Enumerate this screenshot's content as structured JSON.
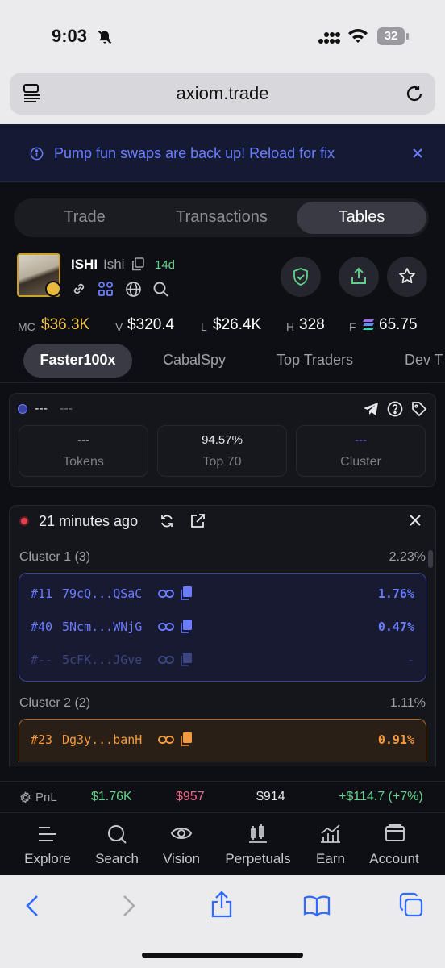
{
  "status": {
    "time": "9:03",
    "battery": "32"
  },
  "browser": {
    "url": "axiom.trade"
  },
  "banner": {
    "text": "Pump fun swaps are back up! Reload for fix"
  },
  "tabs": [
    {
      "label": "Trade"
    },
    {
      "label": "Transactions"
    },
    {
      "label": "Tables"
    }
  ],
  "token": {
    "symbol": "ISHI",
    "name": "Ishi",
    "age": "14d"
  },
  "stats": {
    "mc_label": "MC",
    "mc": "$36.3K",
    "v_label": "V",
    "v": "$320.4",
    "l_label": "L",
    "l": "$26.4K",
    "h_label": "H",
    "h": "328",
    "f_label": "F",
    "f": "65.75"
  },
  "subtabs": [
    {
      "label": "Faster100x"
    },
    {
      "label": "CabalSpy"
    },
    {
      "label": "Top Traders"
    },
    {
      "label": "Dev T"
    }
  ],
  "panel1": {
    "title": "---",
    "subtitle": "---",
    "boxes": [
      {
        "value": "---",
        "label": "Tokens"
      },
      {
        "value": "94.57%",
        "label": "Top 70"
      },
      {
        "value": "---",
        "label": "Cluster"
      }
    ]
  },
  "panel2": {
    "time": "21 minutes ago",
    "clusters": [
      {
        "title": "Cluster 1 (3)",
        "pct": "2.23%",
        "rows": [
          {
            "rank": "#11",
            "addr": "79cQ...QSaC",
            "pct": "1.76%"
          },
          {
            "rank": "#40",
            "addr": "5Ncm...WNjG",
            "pct": "0.47%"
          },
          {
            "rank": "#--",
            "addr": "5cFK...JGve",
            "pct": "-"
          }
        ]
      },
      {
        "title": "Cluster 2 (2)",
        "pct": "1.11%",
        "rows": [
          {
            "rank": "#23",
            "addr": "Dg3y...banH",
            "pct": "0.91%"
          }
        ]
      }
    ]
  },
  "pnl": {
    "label": "PnL",
    "a": "$1.76K",
    "b": "$957",
    "c": "$914",
    "d": "+$114.7 (+7%)"
  },
  "nav": [
    {
      "label": "Explore"
    },
    {
      "label": "Search"
    },
    {
      "label": "Vision"
    },
    {
      "label": "Perpetuals"
    },
    {
      "label": "Earn"
    },
    {
      "label": "Account"
    }
  ],
  "colors": {
    "accent_blue": "#6b7cff",
    "gain": "#5fd38a",
    "loss": "#f06a8c",
    "mc_yellow": "#f2c94c",
    "cluster2": "#f59b3d"
  }
}
